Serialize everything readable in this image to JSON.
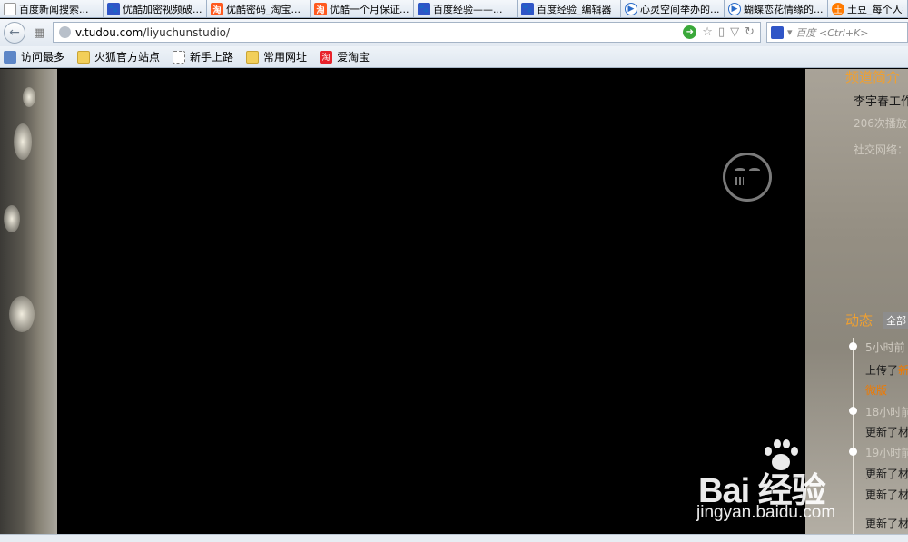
{
  "tabs": [
    {
      "label": "百度新闻搜索...",
      "icon": "page-icon"
    },
    {
      "label": "优酷加密视频破...",
      "icon": "baidu-paw-icon"
    },
    {
      "label": "优酷密码_淘宝...",
      "icon": "taobao-icon"
    },
    {
      "label": "优酷一个月保证...",
      "icon": "taobao-icon"
    },
    {
      "label": "百度经验——...",
      "icon": "baidu-paw-icon"
    },
    {
      "label": "百度经验_编辑器",
      "icon": "baidu-paw-icon"
    },
    {
      "label": "心灵空间举办的...",
      "icon": "play-icon"
    },
    {
      "label": "蝴蝶恋花情缘的...",
      "icon": "play-icon"
    },
    {
      "label": "土豆_每个人都",
      "icon": "tudou-icon"
    }
  ],
  "tab_icon_glyphs": {
    "taobao": "淘",
    "play": "▶",
    "tudou": "土"
  },
  "navbar": {
    "url_domain": "v.tudou.com",
    "url_path": "/liyuchunstudio/",
    "search_placeholder": "百度 <Ctrl+K>"
  },
  "bookmarks": [
    {
      "label": "访问最多",
      "icon": "bookmark-star-icon"
    },
    {
      "label": "火狐官方站点",
      "icon": "folder-icon"
    },
    {
      "label": "新手上路",
      "icon": "page-icon"
    },
    {
      "label": "常用网址",
      "icon": "folder-icon"
    },
    {
      "label": "爱淘宝",
      "icon": "taobao-icon"
    }
  ],
  "sidebar": {
    "title": "频道简介",
    "author": "李宇春工作",
    "views": "206次播放",
    "social": "社交网络：",
    "feed_title": "动态",
    "feed_all": "全部",
    "feed": {
      "t1": "5小时前",
      "text1_prefix": "上传了",
      "text1_highlight": "新",
      "link1": "微版",
      "t2": "18小时前",
      "text2": "更新了材",
      "t3": "19小时前",
      "text3": "更新了材",
      "text4": "更新了材",
      "text5": "更新了材"
    }
  },
  "watermark": {
    "brand": "Bai  经验",
    "url": "jingyan.baidu.com"
  },
  "colors": {
    "accent_orange": "#f0a030",
    "link_orange": "#f07a00",
    "player_bg": "#000000"
  }
}
